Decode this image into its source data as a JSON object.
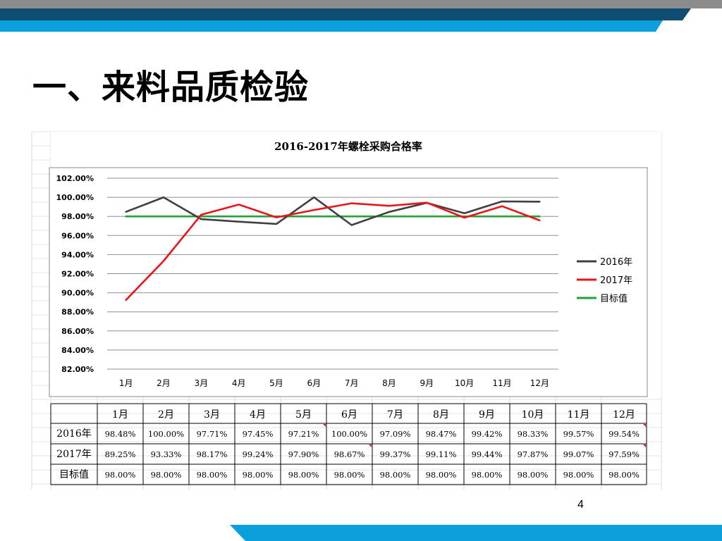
{
  "slide": {
    "title": "一、来料品质检验",
    "page_number": "4"
  },
  "colors": {
    "header_gray": "#8c8c8c",
    "header_dark_blue": "#0f4d73",
    "header_light_blue": "#0ba0db",
    "footer_blue": "#0ba0db",
    "series_2016": "#404040",
    "series_2017": "#e8161b",
    "series_target": "#21a139"
  },
  "chart_data": {
    "type": "line",
    "title": "2016-2017年螺栓采购合格率",
    "categories": [
      "1月",
      "2月",
      "3月",
      "4月",
      "5月",
      "6月",
      "7月",
      "8月",
      "9月",
      "10月",
      "11月",
      "12月"
    ],
    "y_tick_labels": [
      "102.00%",
      "100.00%",
      "98.00%",
      "96.00%",
      "94.00%",
      "92.00%",
      "90.00%",
      "88.00%",
      "86.00%",
      "84.00%",
      "82.00%"
    ],
    "ylim": [
      82,
      102
    ],
    "y_step": 2,
    "grid": true,
    "legend_position": "right",
    "series": [
      {
        "name": "2016年",
        "color": "#404040",
        "values": [
          98.48,
          100.0,
          97.71,
          97.45,
          97.21,
          100.0,
          97.09,
          98.47,
          99.42,
          98.33,
          99.57,
          99.54
        ]
      },
      {
        "name": "2017年",
        "color": "#e8161b",
        "values": [
          89.25,
          93.33,
          98.17,
          99.24,
          97.9,
          98.67,
          99.37,
          99.11,
          99.44,
          97.87,
          99.07,
          97.59
        ]
      },
      {
        "name": "目标值",
        "color": "#21a139",
        "values": [
          98.0,
          98.0,
          98.0,
          98.0,
          98.0,
          98.0,
          98.0,
          98.0,
          98.0,
          98.0,
          98.0,
          98.0
        ]
      }
    ]
  },
  "table": {
    "header": [
      "",
      "1月",
      "2月",
      "3月",
      "4月",
      "5月",
      "6月",
      "7月",
      "8月",
      "9月",
      "10月",
      "11月",
      "12月"
    ],
    "rows": [
      [
        "2016年",
        "98.48%",
        "100.00%",
        "97.71%",
        "97.45%",
        "97.21%",
        "100.00%",
        "97.09%",
        "98.47%",
        "99.42%",
        "98.33%",
        "99.57%",
        "99.54%"
      ],
      [
        "2017年",
        "89.25%",
        "93.33%",
        "98.17%",
        "99.24%",
        "97.90%",
        "98.67%",
        "99.37%",
        "99.11%",
        "99.44%",
        "97.87%",
        "99.07%",
        "97.59%"
      ],
      [
        "目标值",
        "98.00%",
        "98.00%",
        "98.00%",
        "98.00%",
        "98.00%",
        "98.00%",
        "98.00%",
        "98.00%",
        "98.00%",
        "98.00%",
        "98.00%",
        "98.00%"
      ]
    ]
  }
}
